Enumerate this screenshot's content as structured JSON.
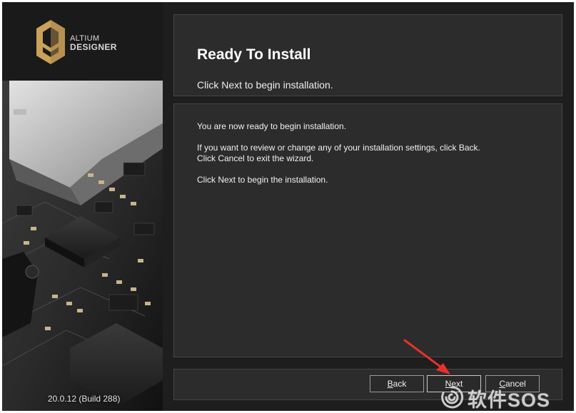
{
  "brand": {
    "line1": "ALTIUM",
    "line2": "DESIGNER",
    "logo_icon": "altium-logo-icon",
    "accent_color": "#c9a15a"
  },
  "version": "20.0.12 (Build 288)",
  "header": {
    "title": "Ready To Install",
    "subtitle": "Click Next to begin installation."
  },
  "content": {
    "paragraph1": "You are now ready to begin installation.",
    "paragraph2_line1": "If you want to review or change any of your installation settings, click Back.",
    "paragraph2_line2": "Click Cancel to exit the wizard.",
    "paragraph3": "Click Next to begin the installation."
  },
  "buttons": {
    "back": {
      "mnemonic": "B",
      "rest": "ack"
    },
    "next": {
      "mnemonic": "N",
      "rest": "ext"
    },
    "cancel": {
      "mnemonic": "C",
      "rest": "ancel"
    }
  },
  "annotation": {
    "arrow_color": "#e8302a",
    "arrow_icon": "red-arrow-icon"
  },
  "watermark": {
    "text": "软件SOS",
    "icon": "spiral-logo-icon"
  }
}
